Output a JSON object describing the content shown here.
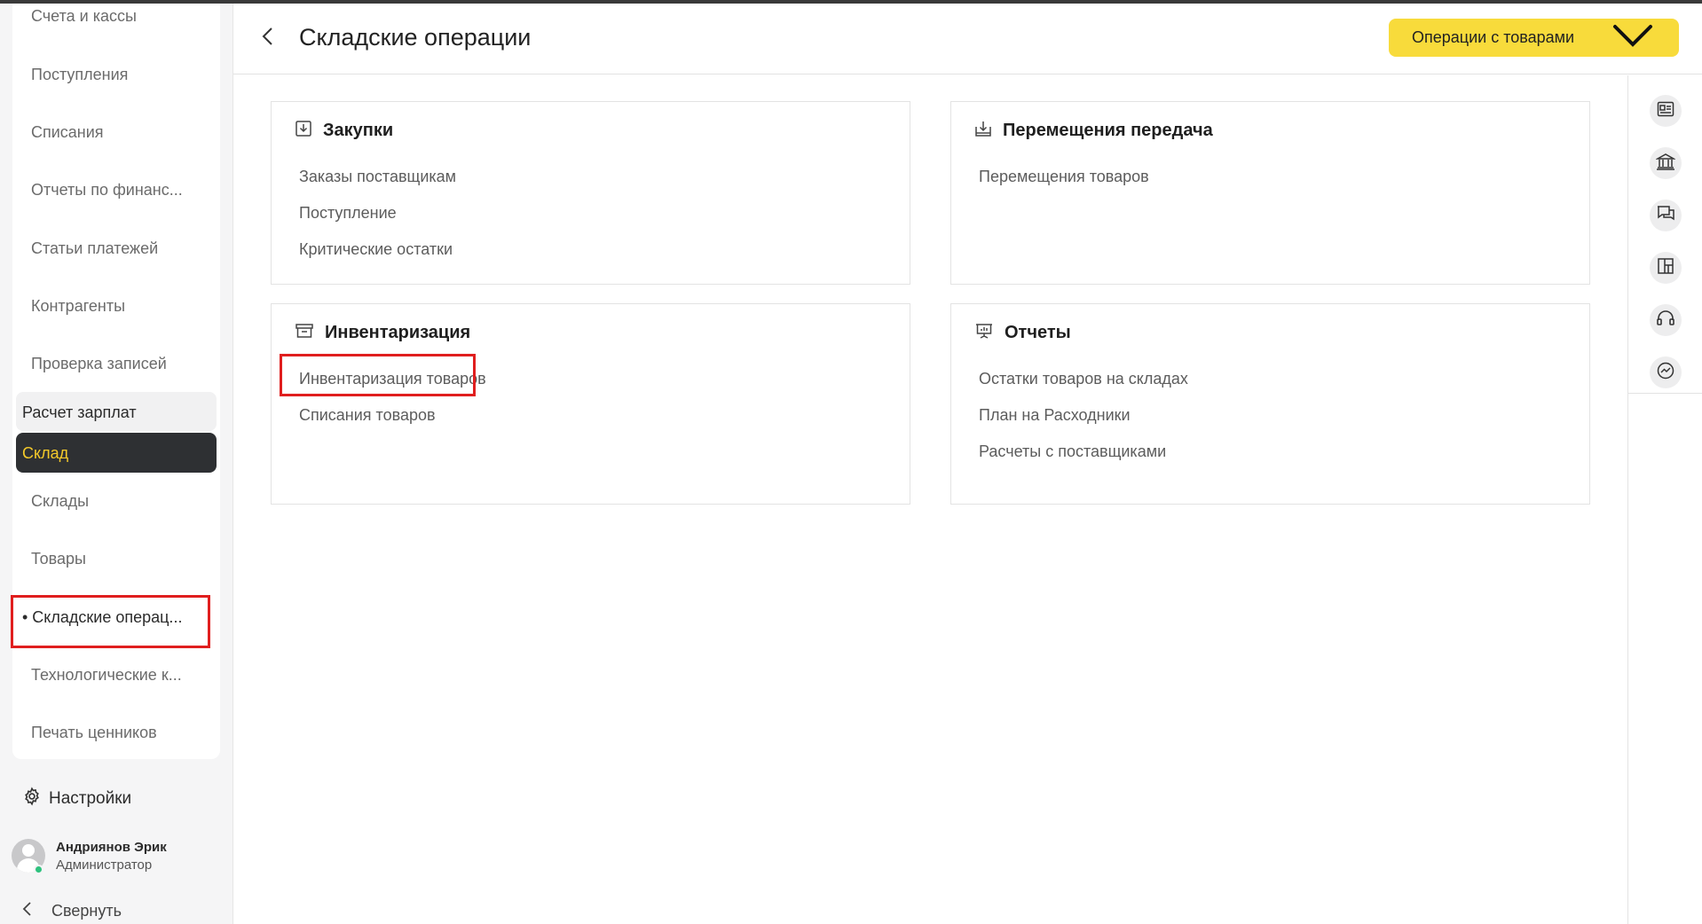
{
  "header": {
    "title": "Складские операции",
    "ops_button": "Операции с товарами"
  },
  "sidebar": {
    "items_top": [
      "Счета и кассы",
      "Поступления",
      "Списания",
      "Отчеты по финанс...",
      "Статьи платежей",
      "Контрагенты",
      "Проверка записей"
    ],
    "subhead": "Расчет зарплат",
    "active": "Склад",
    "items_warehouse": [
      "Склады",
      "Товары",
      "• Складские операц...",
      "Технологические к...",
      "Печать ценников"
    ],
    "settings": "Настройки",
    "user": {
      "name": "Андриянов Эрик",
      "role": "Администратор"
    },
    "collapse": "Свернуть"
  },
  "cards": [
    {
      "title": "Закупки",
      "icon": "download-box-icon",
      "links": [
        "Заказы поставщикам",
        "Поступление",
        "Критические остатки"
      ]
    },
    {
      "title": "Перемещения передача",
      "icon": "transfer-box-icon",
      "links": [
        "Перемещения товаров"
      ]
    },
    {
      "title": "Инвентаризация",
      "icon": "archive-icon",
      "links": [
        "Инвентаризация товаров",
        "Списания товаров"
      ]
    },
    {
      "title": "Отчеты",
      "icon": "presentation-chart-icon",
      "links": [
        "Остатки товаров на складах",
        "План на Расходники",
        "Расчеты с поставщиками"
      ]
    }
  ],
  "right_rail": [
    "id-card-icon",
    "bank-icon",
    "chat-icon",
    "dashboard-icon",
    "headset-icon",
    "messenger-icon"
  ],
  "colors": {
    "accent_yellow": "#f8db3b",
    "active_bg": "#2e3033",
    "active_text": "#f4c92a",
    "highlight_red": "#e01e1e"
  }
}
